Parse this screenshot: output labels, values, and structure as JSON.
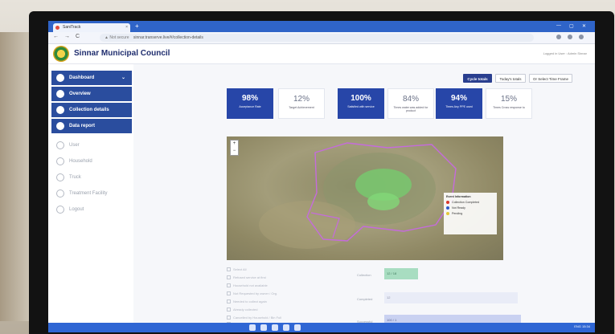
{
  "browser": {
    "tab_title": "SaniTrack",
    "new_tab": "+",
    "close": "×",
    "back": "←",
    "forward": "→",
    "reload": "C",
    "not_secure": "▲ Not secure",
    "url": "sinnar.transerve.live/#/collection-details",
    "minimize": "—",
    "maximize": "▢",
    "close_window": "✕"
  },
  "app": {
    "title": "Sinnar Municipal Council",
    "logged_in": "Logged in User : Admin Sinnar"
  },
  "sidebar": {
    "items": [
      {
        "label": "Dashboard",
        "active": true,
        "caret": "⌄"
      },
      {
        "label": "Overview",
        "active": true
      },
      {
        "label": "Collection details",
        "active": true
      },
      {
        "label": "Data report",
        "active": true
      },
      {
        "label": "User",
        "active": false
      },
      {
        "label": "Household",
        "active": false
      },
      {
        "label": "Truck",
        "active": false
      },
      {
        "label": "Treatment Facility",
        "active": false
      },
      {
        "label": "Logout",
        "active": false
      }
    ]
  },
  "filters": {
    "cycle_totals": "Cycle totals",
    "todays_totals": "Today's totals",
    "select_time_frame": "Or Select Time Frame"
  },
  "kpis": [
    {
      "value": "98%",
      "label": "Acceptance Rate",
      "style": "blue"
    },
    {
      "value": "12%",
      "label": "Target Achievement",
      "style": "light"
    },
    {
      "value": "100%",
      "label": "Satisfied with service",
      "style": "blue"
    },
    {
      "value": "84%",
      "label": "Times water was added for product",
      "style": "light"
    },
    {
      "value": "94%",
      "label": "Times Any PPE used",
      "style": "blue"
    },
    {
      "value": "15%",
      "label": "Times Cross response to",
      "style": "light"
    }
  ],
  "map": {
    "zoom_in": "+",
    "zoom_out": "−",
    "legend_title": "Event Information",
    "legend_items": [
      {
        "label": "Collection Completed",
        "color": "#d8372b"
      },
      {
        "label": "Not Ready",
        "color": "#2d58c6"
      },
      {
        "label": "Pending",
        "color": "#e4c63a"
      }
    ]
  },
  "lower": {
    "checkbox_items": [
      "Select All",
      "Refused service at first",
      "Household not available",
      "Not Requested by owner / Org.",
      "Needed to collect again",
      "Already collected",
      "Cancelled by Household / Bin Full",
      "Household wants to collect later",
      "Other"
    ],
    "bar_rows": [
      {
        "label": "Collection",
        "value": "12 / 18",
        "color": "#a8ddc1"
      },
      {
        "label": "Completed",
        "value": "12",
        "color": "#e9ecf7"
      },
      {
        "label": "Successful",
        "value": "100 / 1",
        "color": "#c9d1f1"
      }
    ]
  },
  "taskbar": {
    "tray_text": "ENG  15:34"
  }
}
